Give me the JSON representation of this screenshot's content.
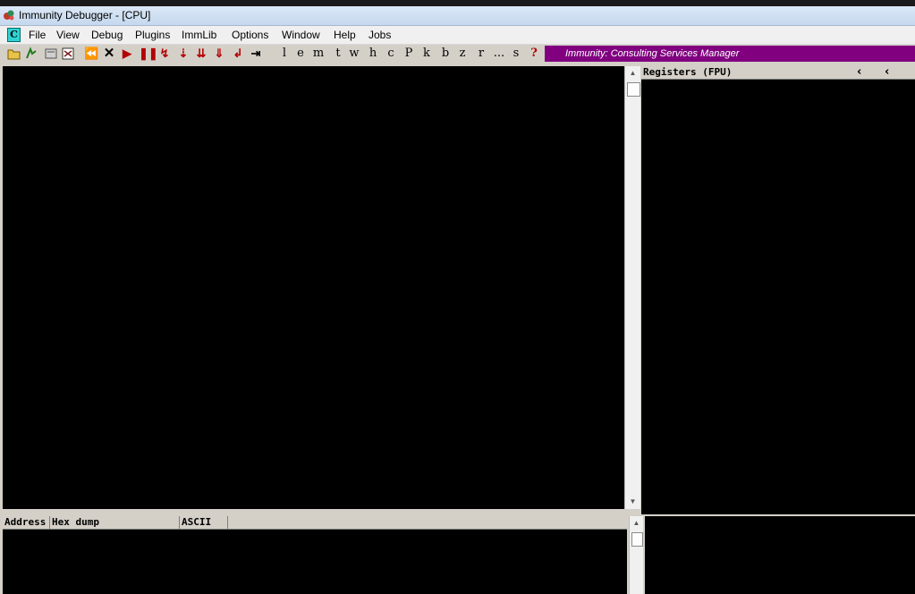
{
  "window": {
    "title": "Immunity Debugger - [CPU]"
  },
  "menu": {
    "badge": "C",
    "items": [
      "File",
      "View",
      "Debug",
      "Plugins",
      "ImmLib",
      "Options",
      "Window",
      "Help",
      "Jobs"
    ]
  },
  "toolbar": {
    "letters": [
      "l",
      "e",
      "m",
      "t",
      "w",
      "h",
      "c",
      "P",
      "k",
      "b",
      "z",
      "r",
      "...",
      "s",
      "?"
    ],
    "promo": "Immunity: Consulting Services Manager"
  },
  "registers": {
    "title": "Registers (FPU)"
  },
  "dump": {
    "columns": [
      "Address",
      "Hex dump",
      "ASCII"
    ]
  },
  "colors": {
    "promo_bg": "#800080",
    "pane_bg": "#000000",
    "badge_bg": "#2cd3d3"
  }
}
